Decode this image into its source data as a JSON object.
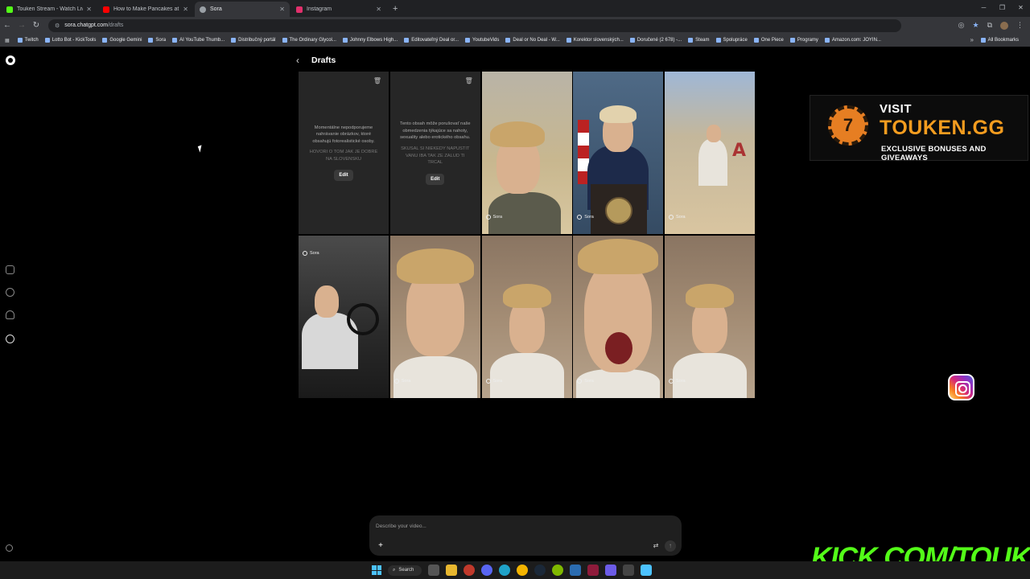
{
  "browser": {
    "tabs": [
      {
        "title": "Touken Stream - Watch Live on",
        "color": "#53fc18",
        "active": false
      },
      {
        "title": "How to Make Pancakes at Hom",
        "color": "#ff0000",
        "active": false
      },
      {
        "title": "Sora",
        "color": "#9aa0a6",
        "active": true
      },
      {
        "title": "Instagram",
        "color": "#e1306c",
        "active": false
      }
    ],
    "new_tab": "+",
    "url_host": "sora.chatgpt.com",
    "url_path": "/drafts",
    "bookmarks": [
      "Twitch",
      "Lotto Bot - KickTools",
      "Google Gemini",
      "Sora",
      "AI YouTube Thumb...",
      "Distribučný portál",
      "The Ordinary Glycol...",
      "Johnny Elbows High...",
      "Editovateľný Deal or...",
      "YoutubeVids",
      "Deal or No Deal - W...",
      "Korektor slovenských...",
      "Doručené (2 678) -...",
      "Steam",
      "Spolupráce",
      "One Piece",
      "Programy",
      "Amazon.com: JOYIN..."
    ],
    "all_bookmarks": "All Bookmarks"
  },
  "page": {
    "back_icon": "‹",
    "title": "Drafts"
  },
  "drafts": {
    "blocked": [
      {
        "message": "Momentálne nepodporujeme nahrávanie obrázkov, ktoré obsahujú fotorealistické osoby.",
        "prompt": "HOVORI O TOM JAK JE DOBRE NA SLOVENSKU",
        "edit": "Edit"
      },
      {
        "message": "Tento obsah môže porušovať naše obmedzenia týkajúce sa nahoty, sexuality alebo erotického obsahu.",
        "prompt": "SKUSAL SI NIEKEDY NAPUSTIT VANU IBA TAK ZE ZALUD TI TRCAL",
        "edit": "Edit"
      }
    ],
    "sora_tag": "Sora"
  },
  "composer": {
    "placeholder": "Describe your video...",
    "plus": "+",
    "send": "↑"
  },
  "promo": {
    "visit": "VISIT",
    "brand": "TOUKEN.GG",
    "tagline": "EXCLUSIVE BONUSES AND GIVEAWAYS",
    "chip_glyph": "7"
  },
  "stream_overlay": {
    "kick": "KICK.COM/TOUKEN"
  },
  "taskbar": {
    "search": "Search"
  },
  "colors": {
    "accent_kick": "#53fc18",
    "promo_orange": "#f39c1f"
  }
}
